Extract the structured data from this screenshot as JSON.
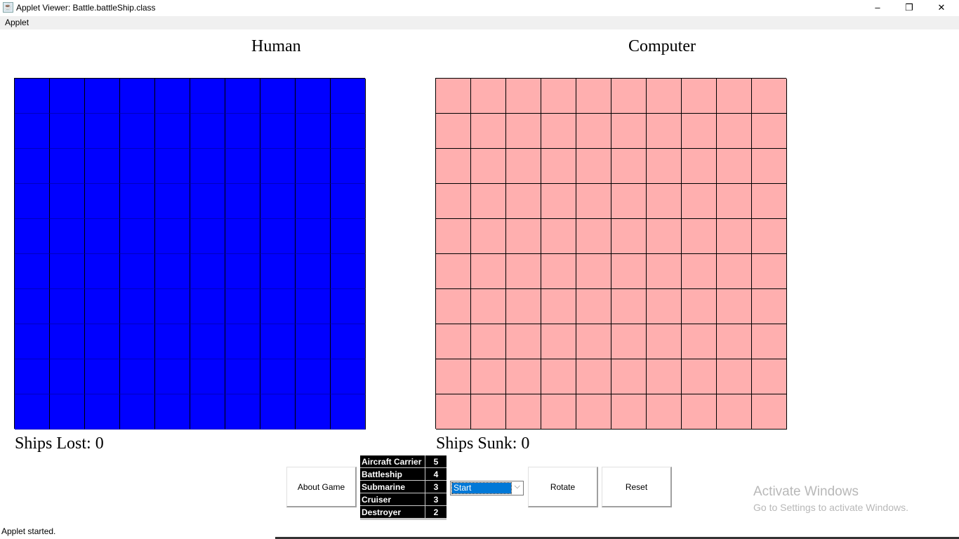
{
  "window": {
    "title": "Applet Viewer: Battle.battleShip.class",
    "minimize": "–",
    "maximize": "❐",
    "close": "✕"
  },
  "menu": {
    "items": [
      "Applet"
    ]
  },
  "human": {
    "heading": "Human",
    "status_label": "Ships Lost: 0",
    "rows": 10,
    "cols": 10,
    "cell_color": "#0000ff"
  },
  "computer": {
    "heading": "Computer",
    "status_label": "Ships Sunk: 0",
    "rows": 10,
    "cols": 10,
    "cell_color": "#ffafaf"
  },
  "controls": {
    "about_label": "About Game",
    "rotate_label": "Rotate",
    "reset_label": "Reset",
    "mode_select": {
      "selected": "Start"
    }
  },
  "ships": [
    {
      "name": "Aircraft Carrier",
      "size": "5"
    },
    {
      "name": "Battleship",
      "size": "4"
    },
    {
      "name": "Submarine",
      "size": "3"
    },
    {
      "name": "Cruiser",
      "size": "3"
    },
    {
      "name": "Destroyer",
      "size": "2"
    }
  ],
  "watermark": {
    "line1": "Activate Windows",
    "line2": "Go to Settings to activate Windows."
  },
  "status_bar": "Applet started."
}
